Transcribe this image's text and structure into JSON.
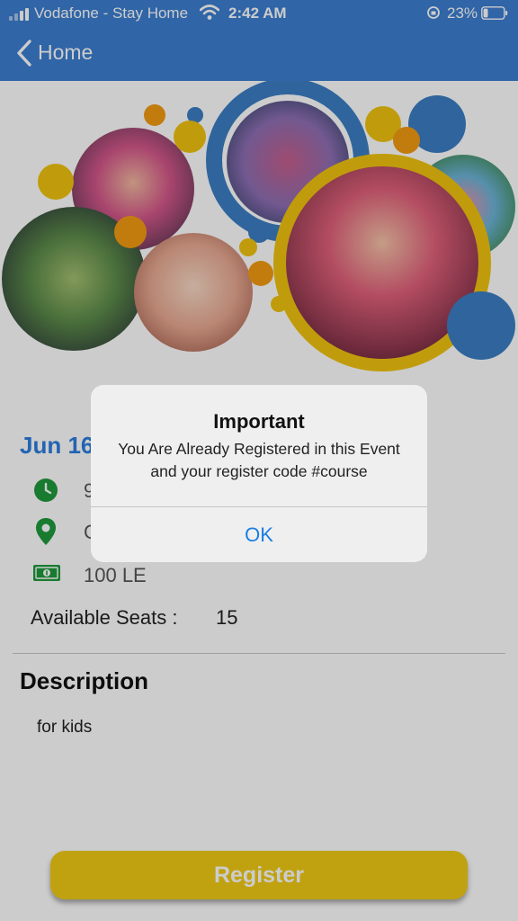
{
  "status_bar": {
    "carrier": "Vodafone - Stay Home",
    "time": "2:42 AM",
    "battery_percent": "23%",
    "battery_level": 0.23
  },
  "nav": {
    "back_label": "Home"
  },
  "event": {
    "date": "Jun 16",
    "time_text": "9",
    "location_text": "C",
    "price": "100 LE",
    "seats_label": "Available Seats :",
    "seats_value": "15"
  },
  "description": {
    "title": "Description",
    "text": "for kids"
  },
  "register_label": "Register",
  "alert": {
    "title": "Important",
    "message": "You Are Already Registered in this Event and your register code #course",
    "ok_label": "OK"
  },
  "icons": {
    "time": "clock-icon",
    "location": "location-pin-icon",
    "price": "cash-icon"
  },
  "colors": {
    "nav_bar": "#3c7fd1",
    "accent": "#2b7de0",
    "icon_green": "#1f9a3d",
    "register_button": "#f0cb16",
    "circle_blue": "#3b7fc4",
    "circle_yellow": "#f1c40f",
    "circle_orange": "#f39c12"
  }
}
